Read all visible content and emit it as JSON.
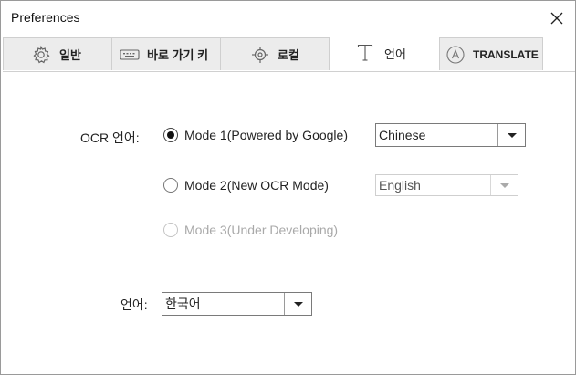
{
  "window": {
    "title": "Preferences"
  },
  "tabs": [
    {
      "label": "일반",
      "icon": "gear-icon",
      "active": false
    },
    {
      "label": "바로 가기 키",
      "icon": "keyboard-icon",
      "active": false
    },
    {
      "label": "로컬",
      "icon": "crosshair-target-icon",
      "active": false
    },
    {
      "label": "언어",
      "icon": "text-T-icon",
      "active": true
    },
    {
      "label": "TRANSLATE",
      "icon": "translate-A-icon",
      "active": false
    }
  ],
  "ocr": {
    "label": "OCR 언어:",
    "modes": [
      {
        "label": "Mode 1(Powered by Google)",
        "checked": true,
        "enabled": true
      },
      {
        "label": "Mode 2(New OCR Mode)",
        "checked": false,
        "enabled": true
      },
      {
        "label": "Mode 3(Under Developing)",
        "checked": false,
        "enabled": false
      }
    ],
    "mode1_language": "Chinese",
    "mode2_language": "English"
  },
  "ui_language": {
    "label": "언어:",
    "value": "한국어"
  },
  "colors": {
    "tab_inactive_bg": "#ececec",
    "disabled_text": "#a9a9a9"
  }
}
